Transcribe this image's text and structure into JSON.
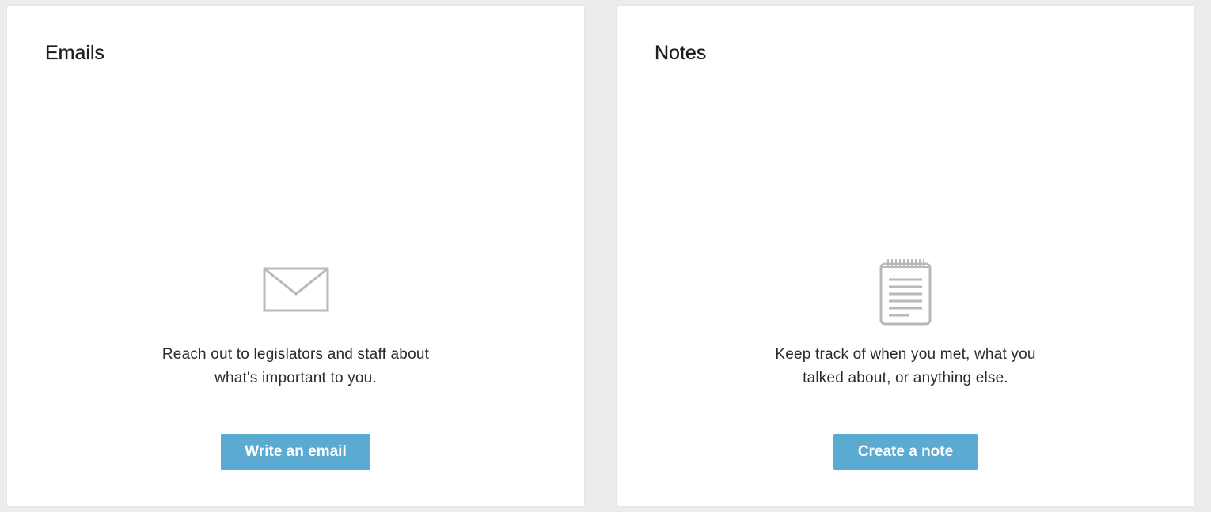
{
  "emails_panel": {
    "title": "Emails",
    "icon": "envelope-icon",
    "description_line1": "Reach out to legislators and staff about",
    "description_line2": "what's important to you.",
    "button_label": "Write an email"
  },
  "notes_panel": {
    "title": "Notes",
    "icon": "notepad-icon",
    "description_line1": "Keep track of when you met, what you",
    "description_line2": "talked about, or anything else.",
    "button_label": "Create a note"
  },
  "colors": {
    "page_background": "#ececec",
    "card_background": "#ffffff",
    "button_background": "#5aaad2",
    "button_text": "#ffffff",
    "icon_stroke": "#b9b9b9"
  }
}
